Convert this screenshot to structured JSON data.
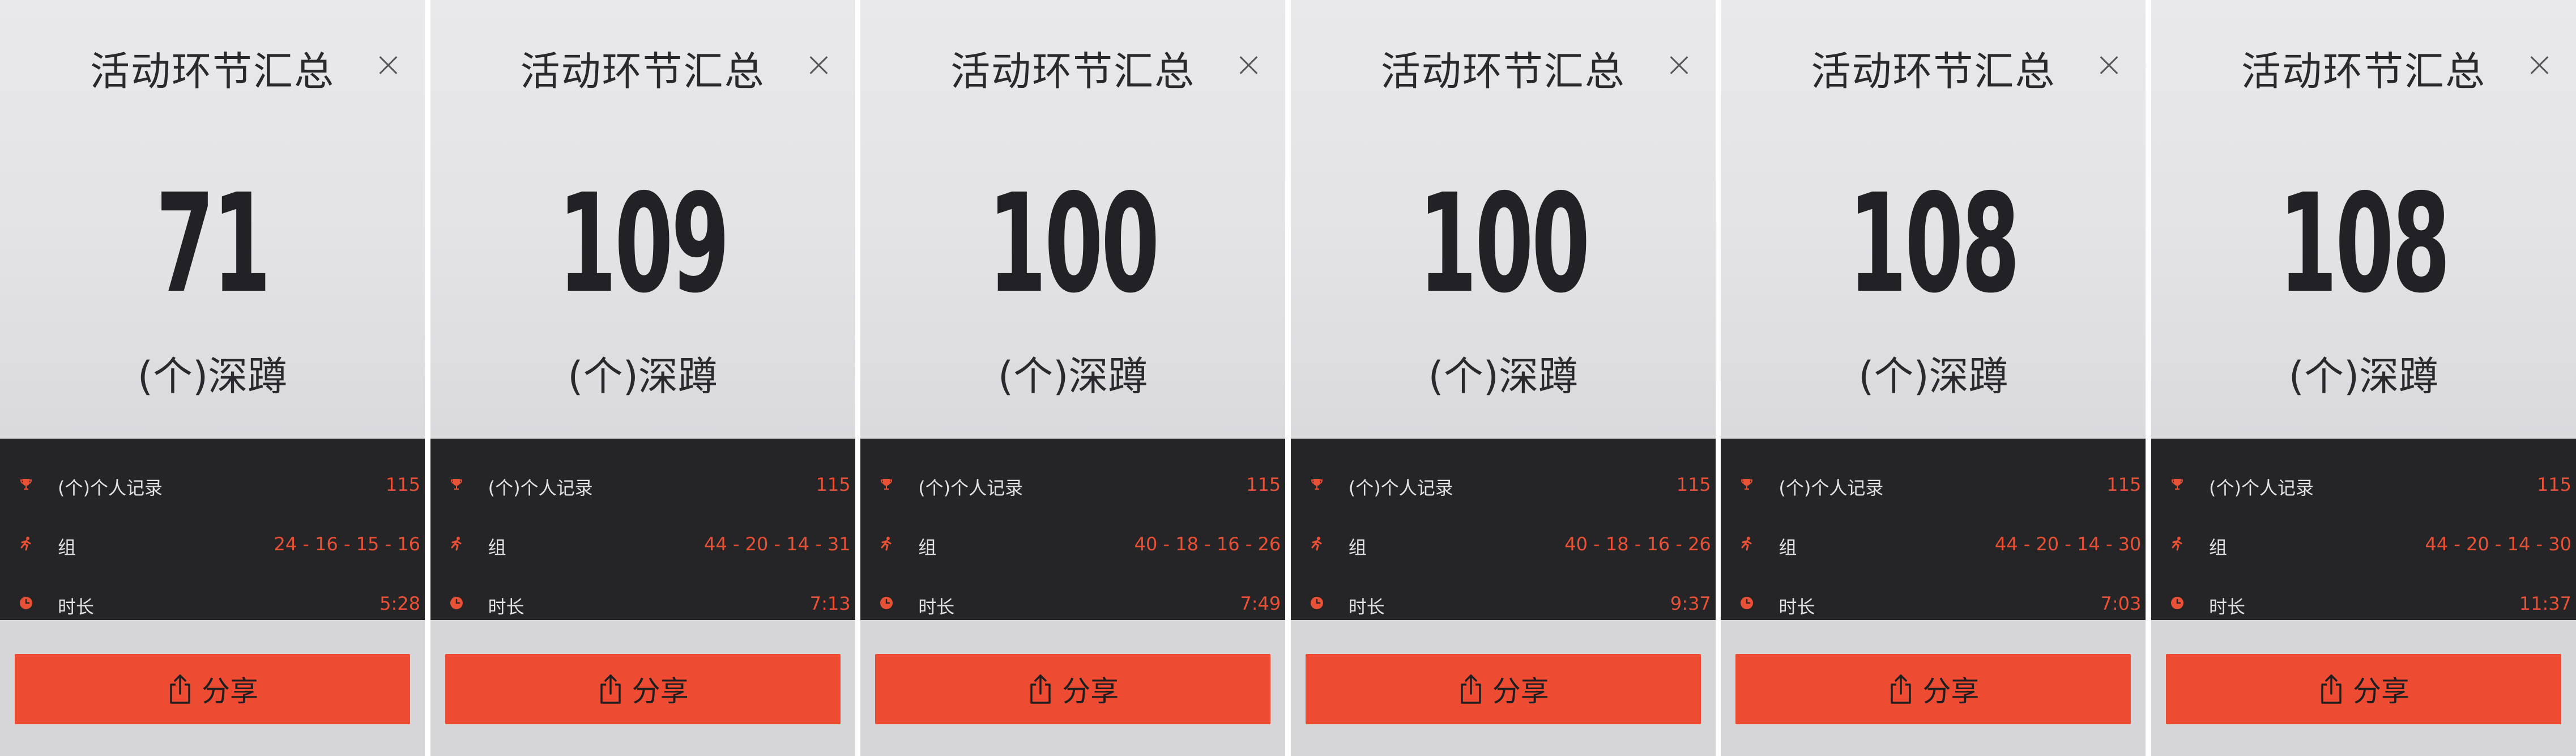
{
  "colors": {
    "accent": "#ee4c32",
    "value_text": "#e85136",
    "dark_band": "#252528",
    "top_bg": "#e5e5e8"
  },
  "common": {
    "title": "活动环节汇总",
    "unit": "(个)深蹲",
    "record_label": "(个)个人记录",
    "sets_label": "组",
    "duration_label": "时长",
    "share_label": "分享",
    "icons": {
      "close": "close-icon",
      "record": "trophy-icon",
      "sets": "runner-icon",
      "duration": "clock-icon",
      "share": "share-icon"
    }
  },
  "screens": [
    {
      "count": "71",
      "record": "115",
      "sets": "24 - 16 - 15 - 16",
      "duration": "5:28"
    },
    {
      "count": "109",
      "record": "115",
      "sets": "44 - 20 - 14 - 31",
      "duration": "7:13"
    },
    {
      "count": "100",
      "record": "115",
      "sets": "40 - 18 - 16 - 26",
      "duration": "7:49"
    },
    {
      "count": "100",
      "record": "115",
      "sets": "40 - 18 - 16 - 26",
      "duration": "9:37"
    },
    {
      "count": "108",
      "record": "115",
      "sets": "44 - 20 - 14 - 30",
      "duration": "7:03"
    },
    {
      "count": "108",
      "record": "115",
      "sets": "44 - 20 - 14 - 30",
      "duration": "11:37"
    }
  ]
}
